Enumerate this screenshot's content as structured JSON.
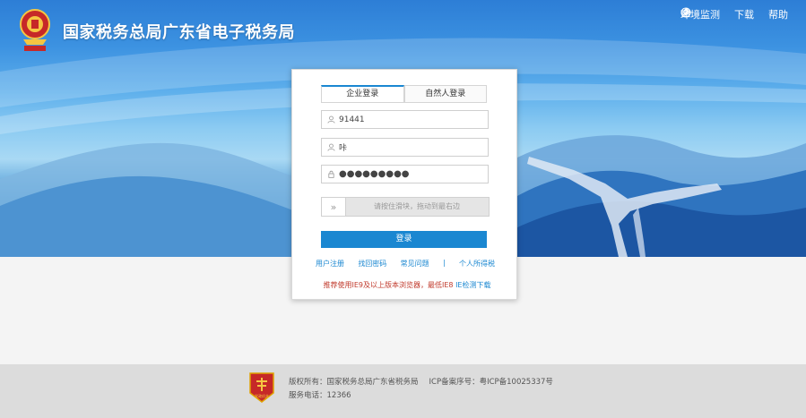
{
  "header": {
    "title": "国家税务总局广东省电子税务局",
    "links": [
      {
        "label": "环境监测",
        "icon": "wrench-icon"
      },
      {
        "label": "下载",
        "icon": "download-icon"
      },
      {
        "label": "帮助",
        "icon": "help-icon"
      }
    ]
  },
  "login": {
    "tabs": [
      "企业登录",
      "自然人登录"
    ],
    "active_tab": 0,
    "taxpayer_id": "91441",
    "username": "咔",
    "password_mask": "●●●●●●●●●",
    "slider_text": "请按住滑块，拖动到最右边",
    "submit_label": "登录",
    "links": [
      "用户注册",
      "找回密码",
      "常见问题",
      "个人所得税"
    ],
    "link_separator": "|",
    "browser_notice": "推荐使用IE9及以上版本浏览器，最低IE8",
    "browser_check_link": "IE检测下载"
  },
  "footer": {
    "copyright": "版权所有：国家税务总局广东省税务局",
    "icp": "ICP备案序号：粤ICP备10025337号",
    "phone": "服务电话：12366",
    "seal_text": "党政机关"
  },
  "colors": {
    "accent": "#1a87d1",
    "notice": "#c0392b",
    "banner_top": "#2d7ed6"
  }
}
